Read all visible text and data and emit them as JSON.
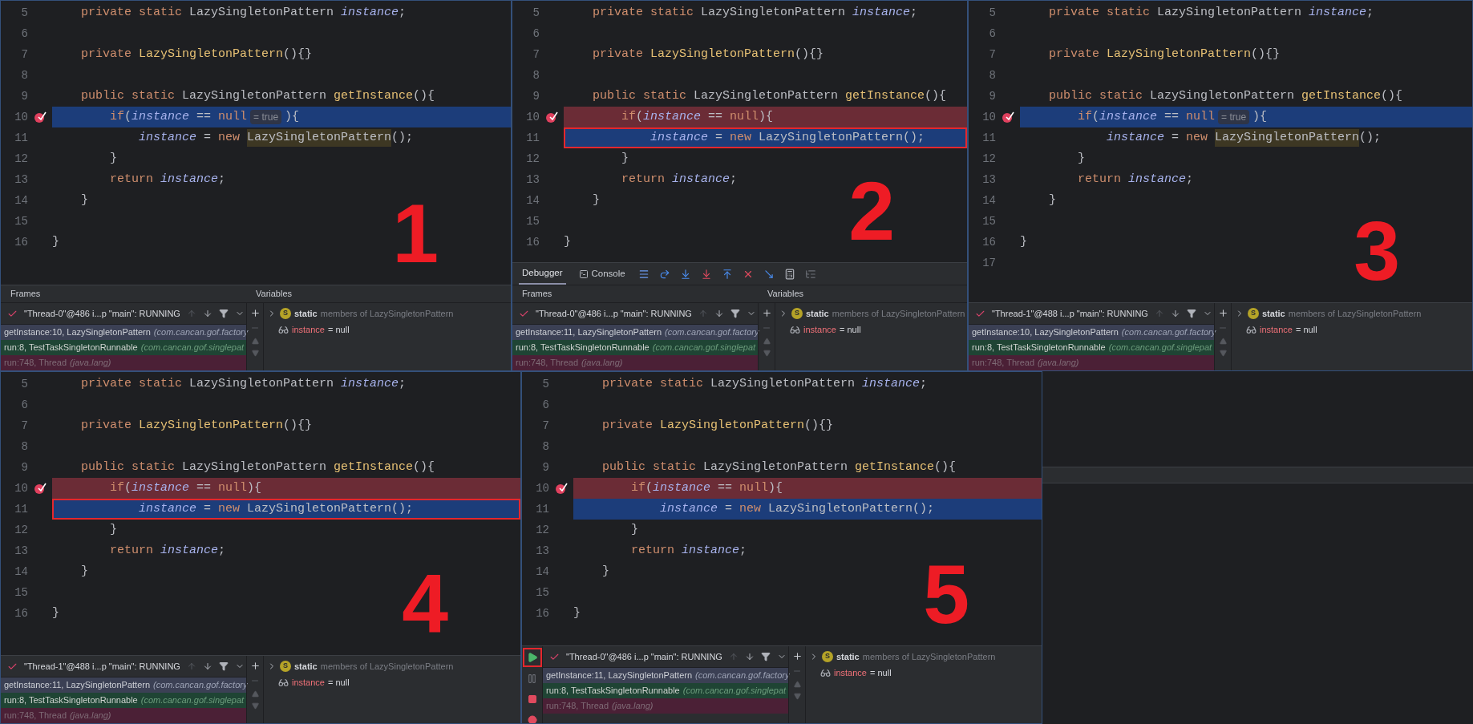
{
  "panels": [
    {
      "number": "1",
      "lines": [
        {
          "no": "5",
          "mark": false,
          "kind": "normal",
          "boxed": false,
          "code": [
            {
              "kind": "kw",
              "text": "    private static "
            },
            {
              "kind": "plain",
              "text": "LazySingletonPattern "
            },
            {
              "kind": "field",
              "text": "instance"
            },
            {
              "kind": "plain",
              "text": ";"
            }
          ]
        },
        {
          "no": "6",
          "mark": false,
          "kind": "normal",
          "boxed": false
        },
        {
          "no": "7",
          "mark": false,
          "kind": "normal",
          "boxed": false,
          "code": [
            {
              "kind": "kw",
              "text": "    private "
            },
            {
              "kind": "decl",
              "text": "LazySingletonPattern"
            },
            {
              "kind": "plain",
              "text": "(){}"
            }
          ]
        },
        {
          "no": "8",
          "mark": false,
          "kind": "normal",
          "boxed": false
        },
        {
          "no": "9",
          "mark": false,
          "kind": "normal",
          "boxed": false,
          "code": [
            {
              "kind": "kw",
              "text": "    public static "
            },
            {
              "kind": "plain",
              "text": "LazySingletonPattern "
            },
            {
              "kind": "decl",
              "text": "getInstance"
            },
            {
              "kind": "plain",
              "text": "(){"
            }
          ]
        },
        {
          "no": "10",
          "mark": true,
          "kind": "current",
          "boxed": false,
          "code": [
            {
              "kind": "kw",
              "text": "        if"
            },
            {
              "kind": "plain",
              "text": "("
            },
            {
              "kind": "field",
              "text": "instance"
            },
            {
              "kind": "plain",
              "text": " == "
            },
            {
              "kind": "kw",
              "text": "null"
            },
            {
              "kind": "hint",
              "text": "= true"
            },
            {
              "kind": "plain",
              "text": "){"
            }
          ]
        },
        {
          "no": "11",
          "mark": false,
          "kind": "normal",
          "boxed": false,
          "code": [
            {
              "kind": "field",
              "text": "            instance"
            },
            {
              "kind": "plain",
              "text": " = "
            },
            {
              "kind": "kw",
              "text": "new "
            },
            {
              "kind": "match",
              "text": "LazySingletonPattern"
            },
            {
              "kind": "plain",
              "text": "();"
            }
          ]
        },
        {
          "no": "12",
          "mark": false,
          "kind": "normal",
          "boxed": false,
          "code": [
            {
              "kind": "plain",
              "text": "        }"
            }
          ]
        },
        {
          "no": "13",
          "mark": false,
          "kind": "normal",
          "boxed": false,
          "code": [
            {
              "kind": "kw",
              "text": "        return "
            },
            {
              "kind": "field",
              "text": "instance"
            },
            {
              "kind": "plain",
              "text": ";"
            }
          ]
        },
        {
          "no": "14",
          "mark": false,
          "kind": "normal",
          "boxed": false,
          "code": [
            {
              "kind": "plain",
              "text": "    }"
            }
          ]
        },
        {
          "no": "15",
          "mark": false,
          "kind": "normal",
          "boxed": false
        },
        {
          "no": "16",
          "mark": false,
          "kind": "normal",
          "boxed": false,
          "code": [
            {
              "kind": "plain",
              "text": "}"
            }
          ]
        }
      ],
      "debugger": {
        "headers": [
          "Frames",
          "Variables"
        ],
        "thread": "\"Thread-0\"@486 i...p \"main\": RUNNING",
        "frames": [
          {
            "method": "getInstance:10, LazySingletonPattern",
            "pkg": "(com.cancan.gof.factory",
            "kind": "selected"
          },
          {
            "method": "run:8, TestTaskSingletonRunnable",
            "pkg": "(com.cancan.gof.singlepat",
            "kind": "project"
          },
          {
            "method": "run:748, Thread",
            "pkg": "(java.lang)",
            "kind": "library"
          }
        ],
        "variables": [
          {
            "kind": "static",
            "badge": "S",
            "name": "static",
            "value": "members of LazySingletonPattern"
          },
          {
            "kind": "field",
            "name": "instance",
            "value": "= null"
          }
        ]
      }
    },
    {
      "number": "2",
      "lines": [
        {
          "no": "5",
          "mark": false,
          "kind": "normal",
          "boxed": false,
          "code": [
            {
              "kind": "kw",
              "text": "    private static "
            },
            {
              "kind": "plain",
              "text": "LazySingletonPattern "
            },
            {
              "kind": "field",
              "text": "instance"
            },
            {
              "kind": "plain",
              "text": ";"
            }
          ]
        },
        {
          "no": "6",
          "mark": false,
          "kind": "normal",
          "boxed": false
        },
        {
          "no": "7",
          "mark": false,
          "kind": "normal",
          "boxed": false,
          "code": [
            {
              "kind": "kw",
              "text": "    private "
            },
            {
              "kind": "decl",
              "text": "LazySingletonPattern"
            },
            {
              "kind": "plain",
              "text": "(){}"
            }
          ]
        },
        {
          "no": "8",
          "mark": false,
          "kind": "normal",
          "boxed": false
        },
        {
          "no": "9",
          "mark": false,
          "kind": "normal",
          "boxed": false,
          "code": [
            {
              "kind": "kw",
              "text": "    public static "
            },
            {
              "kind": "plain",
              "text": "LazySingletonPattern "
            },
            {
              "kind": "decl",
              "text": "getInstance"
            },
            {
              "kind": "plain",
              "text": "(){"
            }
          ]
        },
        {
          "no": "10",
          "mark": true,
          "kind": "breakpoint",
          "boxed": false,
          "code": [
            {
              "kind": "kw",
              "text": "        if"
            },
            {
              "kind": "plain",
              "text": "("
            },
            {
              "kind": "field",
              "text": "instance"
            },
            {
              "kind": "plain",
              "text": " == "
            },
            {
              "kind": "kw",
              "text": "null"
            },
            {
              "kind": "plain",
              "text": "){"
            }
          ]
        },
        {
          "no": "11",
          "mark": false,
          "kind": "current",
          "boxed": true,
          "code": [
            {
              "kind": "field",
              "text": "            instance"
            },
            {
              "kind": "plain",
              "text": " = "
            },
            {
              "kind": "kw",
              "text": "new "
            },
            {
              "kind": "plain",
              "text": "LazySingletonPattern"
            },
            {
              "kind": "plain",
              "text": "();"
            }
          ]
        },
        {
          "no": "12",
          "mark": false,
          "kind": "normal",
          "boxed": false,
          "code": [
            {
              "kind": "plain",
              "text": "        }"
            }
          ]
        },
        {
          "no": "13",
          "mark": false,
          "kind": "normal",
          "boxed": false,
          "code": [
            {
              "kind": "kw",
              "text": "        return "
            },
            {
              "kind": "field",
              "text": "instance"
            },
            {
              "kind": "plain",
              "text": ";"
            }
          ]
        },
        {
          "no": "14",
          "mark": false,
          "kind": "normal",
          "boxed": false,
          "code": [
            {
              "kind": "plain",
              "text": "    }"
            }
          ]
        },
        {
          "no": "15",
          "mark": false,
          "kind": "normal",
          "boxed": false
        },
        {
          "no": "16",
          "mark": false,
          "kind": "normal",
          "boxed": false,
          "code": [
            {
              "kind": "plain",
              "text": "}"
            }
          ]
        }
      ],
      "debugger": {
        "tabs": [
          {
            "label": "Debugger",
            "selected": true
          },
          {
            "label": "Console",
            "selected": false
          }
        ],
        "tools": [
          {
            "kind": "threads"
          },
          {
            "kind": "step-over"
          },
          {
            "kind": "step-into"
          },
          {
            "kind": "force-step-into"
          },
          {
            "kind": "step-out"
          },
          {
            "kind": "drop-frame"
          },
          {
            "kind": "run-to-cursor"
          },
          {
            "kind": "evaluate"
          },
          {
            "kind": "trace"
          }
        ],
        "headers": [
          "Frames",
          "Variables"
        ],
        "thread": "\"Thread-0\"@486 i...p \"main\": RUNNING",
        "frames": [
          {
            "method": "getInstance:11, LazySingletonPattern",
            "pkg": "(com.cancan.gof.factory",
            "kind": "selected"
          },
          {
            "method": "run:8, TestTaskSingletonRunnable",
            "pkg": "(com.cancan.gof.singlepat",
            "kind": "project"
          },
          {
            "method": "run:748, Thread",
            "pkg": "(java.lang)",
            "kind": "library"
          }
        ],
        "variables": [
          {
            "kind": "static",
            "badge": "S",
            "name": "static",
            "value": "members of LazySingletonPattern"
          },
          {
            "kind": "field",
            "name": "instance",
            "value": "= null"
          }
        ]
      }
    },
    {
      "number": "3",
      "lines": [
        {
          "no": "5",
          "mark": false,
          "kind": "normal",
          "boxed": false,
          "code": [
            {
              "kind": "kw",
              "text": "    private static "
            },
            {
              "kind": "plain",
              "text": "LazySingletonPattern "
            },
            {
              "kind": "field",
              "text": "instance"
            },
            {
              "kind": "plain",
              "text": ";"
            }
          ]
        },
        {
          "no": "6",
          "mark": false,
          "kind": "normal",
          "boxed": false
        },
        {
          "no": "7",
          "mark": false,
          "kind": "normal",
          "boxed": false,
          "code": [
            {
              "kind": "kw",
              "text": "    private "
            },
            {
              "kind": "decl",
              "text": "LazySingletonPattern"
            },
            {
              "kind": "plain",
              "text": "(){}"
            }
          ]
        },
        {
          "no": "8",
          "mark": false,
          "kind": "normal",
          "boxed": false
        },
        {
          "no": "9",
          "mark": false,
          "kind": "normal",
          "boxed": false,
          "code": [
            {
              "kind": "kw",
              "text": "    public static "
            },
            {
              "kind": "plain",
              "text": "LazySingletonPattern "
            },
            {
              "kind": "decl",
              "text": "getInstance"
            },
            {
              "kind": "plain",
              "text": "(){"
            }
          ]
        },
        {
          "no": "10",
          "mark": true,
          "kind": "current",
          "boxed": false,
          "code": [
            {
              "kind": "kw",
              "text": "        if"
            },
            {
              "kind": "plain",
              "text": "("
            },
            {
              "kind": "field",
              "text": "instance"
            },
            {
              "kind": "plain",
              "text": " == "
            },
            {
              "kind": "kw",
              "text": "null"
            },
            {
              "kind": "hint",
              "text": "= true"
            },
            {
              "kind": "plain",
              "text": "){"
            }
          ]
        },
        {
          "no": "11",
          "mark": false,
          "kind": "normal",
          "boxed": false,
          "code": [
            {
              "kind": "field",
              "text": "            instance"
            },
            {
              "kind": "plain",
              "text": " = "
            },
            {
              "kind": "kw",
              "text": "new "
            },
            {
              "kind": "match",
              "text": "LazySingletonPattern"
            },
            {
              "kind": "plain",
              "text": "();"
            }
          ]
        },
        {
          "no": "12",
          "mark": false,
          "kind": "normal",
          "boxed": false,
          "code": [
            {
              "kind": "plain",
              "text": "        }"
            }
          ]
        },
        {
          "no": "13",
          "mark": false,
          "kind": "normal",
          "boxed": false,
          "code": [
            {
              "kind": "kw",
              "text": "        return "
            },
            {
              "kind": "field",
              "text": "instance"
            },
            {
              "kind": "plain",
              "text": ";"
            }
          ]
        },
        {
          "no": "14",
          "mark": false,
          "kind": "normal",
          "boxed": false,
          "code": [
            {
              "kind": "plain",
              "text": "    }"
            }
          ]
        },
        {
          "no": "15",
          "mark": false,
          "kind": "normal",
          "boxed": false
        },
        {
          "no": "16",
          "mark": false,
          "kind": "normal",
          "boxed": false,
          "code": [
            {
              "kind": "plain",
              "text": "}"
            }
          ]
        },
        {
          "no": "17",
          "mark": false,
          "kind": "normal",
          "boxed": false
        }
      ],
      "debugger": {
        "thread": "\"Thread-1\"@488 i...p \"main\": RUNNING",
        "frames": [
          {
            "method": "getInstance:10, LazySingletonPattern",
            "pkg": "(com.cancan.gof.factory",
            "kind": "selected"
          },
          {
            "method": "run:8, TestTaskSingletonRunnable",
            "pkg": "(com.cancan.gof.singlepat",
            "kind": "project"
          },
          {
            "method": "run:748, Thread",
            "pkg": "(java.lang)",
            "kind": "library"
          }
        ],
        "variables": [
          {
            "kind": "static",
            "badge": "S",
            "name": "static",
            "value": "members of LazySingletonPattern"
          },
          {
            "kind": "field",
            "name": "instance",
            "value": "= null"
          }
        ]
      }
    },
    {
      "number": "4",
      "lines": [
        {
          "no": "5",
          "mark": false,
          "kind": "normal",
          "boxed": false,
          "code": [
            {
              "kind": "kw",
              "text": "    private static "
            },
            {
              "kind": "plain",
              "text": "LazySingletonPattern "
            },
            {
              "kind": "field",
              "text": "instance"
            },
            {
              "kind": "plain",
              "text": ";"
            }
          ]
        },
        {
          "no": "6",
          "mark": false,
          "kind": "normal",
          "boxed": false
        },
        {
          "no": "7",
          "mark": false,
          "kind": "normal",
          "boxed": false,
          "code": [
            {
              "kind": "kw",
              "text": "    private "
            },
            {
              "kind": "decl",
              "text": "LazySingletonPattern"
            },
            {
              "kind": "plain",
              "text": "(){}"
            }
          ]
        },
        {
          "no": "8",
          "mark": false,
          "kind": "normal",
          "boxed": false
        },
        {
          "no": "9",
          "mark": false,
          "kind": "normal",
          "boxed": false,
          "code": [
            {
              "kind": "kw",
              "text": "    public static "
            },
            {
              "kind": "plain",
              "text": "LazySingletonPattern "
            },
            {
              "kind": "decl",
              "text": "getInstance"
            },
            {
              "kind": "plain",
              "text": "(){"
            }
          ]
        },
        {
          "no": "10",
          "mark": true,
          "kind": "breakpoint",
          "boxed": false,
          "code": [
            {
              "kind": "kw",
              "text": "        if"
            },
            {
              "kind": "plain",
              "text": "("
            },
            {
              "kind": "field",
              "text": "instance"
            },
            {
              "kind": "plain",
              "text": " == "
            },
            {
              "kind": "kw",
              "text": "null"
            },
            {
              "kind": "plain",
              "text": "){"
            }
          ]
        },
        {
          "no": "11",
          "mark": false,
          "kind": "current",
          "boxed": true,
          "code": [
            {
              "kind": "field",
              "text": "            instance"
            },
            {
              "kind": "plain",
              "text": " = "
            },
            {
              "kind": "kw",
              "text": "new "
            },
            {
              "kind": "plain",
              "text": "LazySingletonPattern"
            },
            {
              "kind": "plain",
              "text": "();"
            }
          ]
        },
        {
          "no": "12",
          "mark": false,
          "kind": "normal",
          "boxed": false,
          "code": [
            {
              "kind": "plain",
              "text": "        }"
            }
          ]
        },
        {
          "no": "13",
          "mark": false,
          "kind": "normal",
          "boxed": false,
          "code": [
            {
              "kind": "kw",
              "text": "        return "
            },
            {
              "kind": "field",
              "text": "instance"
            },
            {
              "kind": "plain",
              "text": ";"
            }
          ]
        },
        {
          "no": "14",
          "mark": false,
          "kind": "normal",
          "boxed": false,
          "code": [
            {
              "kind": "plain",
              "text": "    }"
            }
          ]
        },
        {
          "no": "15",
          "mark": false,
          "kind": "normal",
          "boxed": false
        },
        {
          "no": "16",
          "mark": false,
          "kind": "normal",
          "boxed": false,
          "code": [
            {
              "kind": "plain",
              "text": "}"
            }
          ]
        }
      ],
      "debugger": {
        "thread": "\"Thread-1\"@488 i...p \"main\": RUNNING",
        "frames": [
          {
            "method": "getInstance:11, LazySingletonPattern",
            "pkg": "(com.cancan.gof.factory",
            "kind": "selected"
          },
          {
            "method": "run:8, TestTaskSingletonRunnable",
            "pkg": "(com.cancan.gof.singlepat",
            "kind": "project"
          },
          {
            "method": "run:748, Thread",
            "pkg": "(java.lang)",
            "kind": "library"
          }
        ],
        "variables": [
          {
            "kind": "static",
            "badge": "S",
            "name": "static",
            "value": "members of LazySingletonPattern"
          },
          {
            "kind": "field",
            "name": "instance",
            "value": "= null"
          }
        ]
      }
    },
    {
      "number": "5",
      "lines": [
        {
          "no": "5",
          "mark": false,
          "kind": "normal",
          "boxed": false,
          "code": [
            {
              "kind": "kw",
              "text": "    private static "
            },
            {
              "kind": "plain",
              "text": "LazySingletonPattern "
            },
            {
              "kind": "field",
              "text": "instance"
            },
            {
              "kind": "plain",
              "text": ";"
            }
          ]
        },
        {
          "no": "6",
          "mark": false,
          "kind": "normal",
          "boxed": false
        },
        {
          "no": "7",
          "mark": false,
          "kind": "normal",
          "boxed": false,
          "code": [
            {
              "kind": "kw",
              "text": "    private "
            },
            {
              "kind": "decl",
              "text": "LazySingletonPattern"
            },
            {
              "kind": "plain",
              "text": "(){}"
            }
          ]
        },
        {
          "no": "8",
          "mark": false,
          "kind": "normal",
          "boxed": false
        },
        {
          "no": "9",
          "mark": false,
          "kind": "normal",
          "boxed": false,
          "code": [
            {
              "kind": "kw",
              "text": "    public static "
            },
            {
              "kind": "plain",
              "text": "LazySingletonPattern "
            },
            {
              "kind": "decl",
              "text": "getInstance"
            },
            {
              "kind": "plain",
              "text": "(){"
            }
          ]
        },
        {
          "no": "10",
          "mark": true,
          "kind": "breakpoint",
          "boxed": false,
          "code": [
            {
              "kind": "kw",
              "text": "        if"
            },
            {
              "kind": "plain",
              "text": "("
            },
            {
              "kind": "field",
              "text": "instance"
            },
            {
              "kind": "plain",
              "text": " == "
            },
            {
              "kind": "kw",
              "text": "null"
            },
            {
              "kind": "plain",
              "text": "){"
            }
          ]
        },
        {
          "no": "11",
          "mark": false,
          "kind": "current",
          "boxed": false,
          "code": [
            {
              "kind": "field",
              "text": "            instance"
            },
            {
              "kind": "plain",
              "text": " = "
            },
            {
              "kind": "kw",
              "text": "new "
            },
            {
              "kind": "plain",
              "text": "LazySingletonPattern"
            },
            {
              "kind": "plain",
              "text": "();"
            }
          ]
        },
        {
          "no": "12",
          "mark": false,
          "kind": "normal",
          "boxed": false,
          "code": [
            {
              "kind": "plain",
              "text": "        }"
            }
          ]
        },
        {
          "no": "13",
          "mark": false,
          "kind": "normal",
          "boxed": false,
          "code": [
            {
              "kind": "kw",
              "text": "        return "
            },
            {
              "kind": "field",
              "text": "instance"
            },
            {
              "kind": "plain",
              "text": ";"
            }
          ]
        },
        {
          "no": "14",
          "mark": false,
          "kind": "normal",
          "boxed": false,
          "code": [
            {
              "kind": "plain",
              "text": "    }"
            }
          ]
        },
        {
          "no": "15",
          "mark": false,
          "kind": "normal",
          "boxed": false
        },
        {
          "no": "16",
          "mark": false,
          "kind": "normal",
          "boxed": false,
          "code": [
            {
              "kind": "plain",
              "text": "}"
            }
          ]
        }
      ],
      "debugger": {
        "side_tools": [
          {
            "kind": "resume",
            "boxed": true
          },
          {
            "kind": "pause",
            "boxed": false
          },
          {
            "kind": "stop",
            "boxed": false
          },
          {
            "kind": "mute",
            "boxed": false
          }
        ],
        "thread": "\"Thread-0\"@486 i...p \"main\": RUNNING",
        "frames": [
          {
            "method": "getInstance:11, LazySingletonPattern",
            "pkg": "(com.cancan.gof.factory",
            "kind": "selected"
          },
          {
            "method": "run:8, TestTaskSingletonRunnable",
            "pkg": "(com.cancan.gof.singlepat",
            "kind": "project"
          },
          {
            "method": "run:748, Thread",
            "pkg": "(java.lang)",
            "kind": "library"
          }
        ],
        "variables": [
          {
            "kind": "static",
            "badge": "S",
            "name": "static",
            "value": "members of LazySingletonPattern"
          },
          {
            "kind": "field",
            "name": "instance",
            "value": "= null"
          }
        ]
      }
    }
  ]
}
